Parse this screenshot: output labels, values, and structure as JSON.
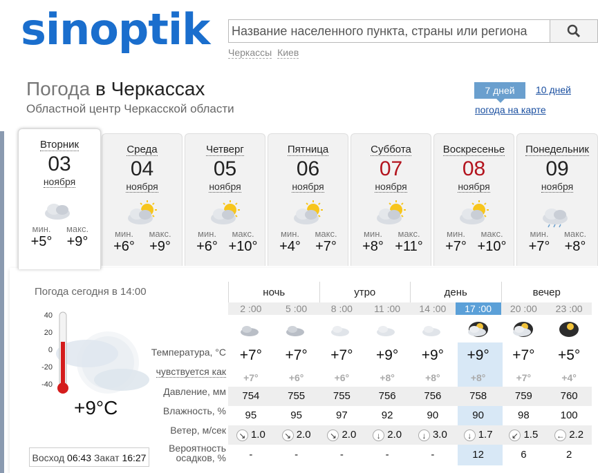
{
  "header": {
    "logo": "sinoptik",
    "search_placeholder": "Название населенного пункта, страны или региона",
    "quick_links": [
      "Черкассы",
      "Киев"
    ]
  },
  "page": {
    "title_grey": "Погода",
    "title_city": "в Черкассах",
    "subtitle": "Областной центр Черкасской области",
    "tab_7": "7 дней",
    "tab_10": "10 дней",
    "map_link": "погода на карте"
  },
  "days": [
    {
      "name": "Вторник",
      "num": "03",
      "month": "ноября",
      "min": "+5°",
      "max": "+9°",
      "icon": "cloudy-icon",
      "weekend": false
    },
    {
      "name": "Среда",
      "num": "04",
      "month": "ноября",
      "min": "+6°",
      "max": "+9°",
      "icon": "partly-cloudy-icon",
      "weekend": false
    },
    {
      "name": "Четверг",
      "num": "05",
      "month": "ноября",
      "min": "+6°",
      "max": "+10°",
      "icon": "partly-cloudy-icon",
      "weekend": false
    },
    {
      "name": "Пятница",
      "num": "06",
      "month": "ноября",
      "min": "+4°",
      "max": "+7°",
      "icon": "partly-cloudy-icon",
      "weekend": false
    },
    {
      "name": "Суббота",
      "num": "07",
      "month": "ноября",
      "min": "+8°",
      "max": "+11°",
      "icon": "partly-cloudy-icon",
      "weekend": true
    },
    {
      "name": "Воскресенье",
      "num": "08",
      "month": "ноября",
      "min": "+7°",
      "max": "+10°",
      "icon": "partly-cloudy-icon",
      "weekend": true
    },
    {
      "name": "Понедельник",
      "num": "09",
      "month": "ноября",
      "min": "+7°",
      "max": "+8°",
      "icon": "rain-icon",
      "weekend": false
    }
  ],
  "labels": {
    "min": "мин.",
    "max": "макс."
  },
  "today": {
    "label": "Погода сегодня в 14:00",
    "temp": "+9°C",
    "scale": [
      "40",
      "20",
      "0",
      "-20",
      "-40"
    ],
    "sunrise_label": "Восход",
    "sunrise": "06:43",
    "sunset_label": "Закат",
    "sunset": "16:27"
  },
  "periods": [
    "ночь",
    "утро",
    "день",
    "вечер"
  ],
  "row_labels": {
    "temp": "Температура, °С",
    "feels": "чувствуется как",
    "pressure": "Давление, мм",
    "humidity": "Влажность, %",
    "wind": "Ветер, м/сек",
    "precip1": "Вероятность",
    "precip2": "осадков, %"
  },
  "hours": [
    "2 :00",
    "5 :00",
    "8 :00",
    "11 :00",
    "14 :00",
    "17 :00",
    "20 :00",
    "23 :00"
  ],
  "temps": [
    "+7°",
    "+7°",
    "+7°",
    "+9°",
    "+9°",
    "+9°",
    "+7°",
    "+5°"
  ],
  "feels": [
    "+7°",
    "+6°",
    "+6°",
    "+8°",
    "+8°",
    "+8°",
    "+7°",
    "+4°"
  ],
  "pressure": [
    "754",
    "755",
    "755",
    "756",
    "756",
    "758",
    "759",
    "760"
  ],
  "humidity": [
    "95",
    "95",
    "97",
    "92",
    "90",
    "90",
    "98",
    "100"
  ],
  "wind": [
    {
      "dir": "↘",
      "v": "1.0"
    },
    {
      "dir": "↘",
      "v": "2.0"
    },
    {
      "dir": "↘",
      "v": "2.0"
    },
    {
      "dir": "↓",
      "v": "2.0"
    },
    {
      "dir": "↓",
      "v": "3.0"
    },
    {
      "dir": "↓",
      "v": "1.7"
    },
    {
      "dir": "↙",
      "v": "1.5"
    },
    {
      "dir": "←",
      "v": "2.2"
    }
  ],
  "precip": [
    "-",
    "-",
    "-",
    "-",
    "-",
    "12",
    "6",
    "2"
  ],
  "colors": {
    "brand": "#1a6ecd",
    "weekend": "#b3141e",
    "highlight": "#5ba0d8"
  }
}
